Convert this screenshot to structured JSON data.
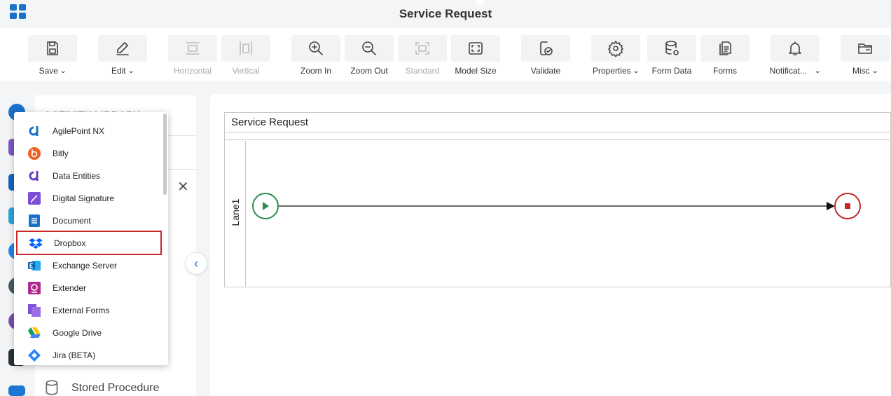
{
  "header": {
    "title": "Service Request"
  },
  "toolbar": {
    "save": "Save",
    "edit": "Edit",
    "horizontal": "Horizontal",
    "vertical": "Vertical",
    "zoom_in": "Zoom In",
    "zoom_out": "Zoom Out",
    "standard": "Standard",
    "model_size": "Model Size",
    "validate": "Validate",
    "properties": "Properties",
    "form_data": "Form Data",
    "forms": "Forms",
    "notifications": "Notificat...",
    "misc": "Misc"
  },
  "library": {
    "title": "ACTIVITY LIBRARY",
    "visible_item": "Stored Procedure"
  },
  "dropdown": {
    "selected": "Dropbox",
    "items": [
      {
        "label": "AgilePoint NX",
        "icon": "agilepoint-icon"
      },
      {
        "label": "Bitly",
        "icon": "bitly-icon"
      },
      {
        "label": "Data Entities",
        "icon": "data-entities-icon"
      },
      {
        "label": "Digital Signature",
        "icon": "digital-signature-icon"
      },
      {
        "label": "Document",
        "icon": "document-icon"
      },
      {
        "label": "Dropbox",
        "icon": "dropbox-icon"
      },
      {
        "label": "Exchange Server",
        "icon": "exchange-icon"
      },
      {
        "label": "Extender",
        "icon": "extender-icon"
      },
      {
        "label": "External Forms",
        "icon": "external-forms-icon"
      },
      {
        "label": "Google Drive",
        "icon": "google-drive-icon"
      },
      {
        "label": "Jira (BETA)",
        "icon": "jira-icon"
      }
    ]
  },
  "canvas": {
    "pool_title": "Service Request",
    "lane_label": "Lane1"
  },
  "colors": {
    "accent": "#1a73c9",
    "start_event": "#2e8b4e",
    "end_event": "#c62828",
    "selection_border": "#c62828"
  }
}
